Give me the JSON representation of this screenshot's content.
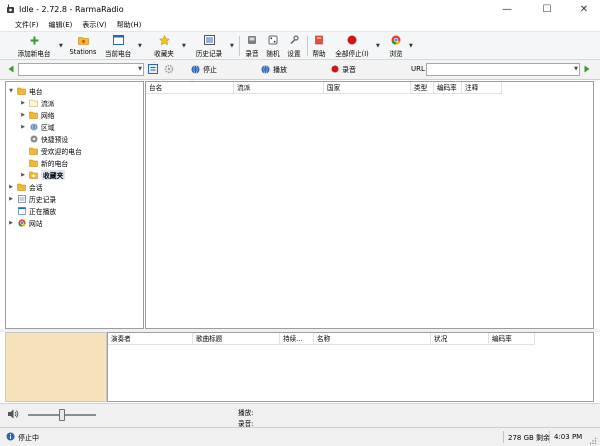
{
  "window": {
    "title": "Idle - 2.72.8 - RarmaRadio",
    "controls": {
      "minimize": "—",
      "maximize": "☐",
      "close": "✕"
    }
  },
  "menu": [
    "文件(F)",
    "编辑(E)",
    "表示(V)",
    "帮助(H)"
  ],
  "toolbar": {
    "add_station": "添加新电台",
    "stations": "Stations",
    "current_station": "当前电台",
    "favorites": "收藏夹",
    "history": "历史记录",
    "record": "录音",
    "random": "随机",
    "settings": "设置",
    "help": "帮助",
    "stop_all": "全部停止(I)",
    "browse": "浏览"
  },
  "address_bar": {
    "station_value": "",
    "stop": "停止",
    "play": "播放",
    "record": "录音",
    "url_label": "URL",
    "url_value": ""
  },
  "tree": [
    {
      "label": "电台",
      "icon": "radio-icon",
      "expanded": true
    },
    {
      "label": "流派",
      "icon": "folder-icon"
    },
    {
      "label": "网络",
      "icon": "network-folder-icon"
    },
    {
      "label": "区域",
      "icon": "globe-icon"
    },
    {
      "label": "快捷预设",
      "icon": "preset-icon"
    },
    {
      "label": "受欢迎的电台",
      "icon": "star-folder-icon"
    },
    {
      "label": "新的电台",
      "icon": "new-folder-icon"
    },
    {
      "label": "收藏夹",
      "icon": "favorites-icon",
      "selected": true
    },
    {
      "label": "会话",
      "icon": "session-icon"
    },
    {
      "label": "历史记录",
      "icon": "history-icon"
    },
    {
      "label": "正在播放",
      "icon": "now-playing-icon"
    },
    {
      "label": "网站",
      "icon": "chrome-icon"
    }
  ],
  "station_columns": [
    "台名",
    "流派",
    "国家",
    "类型",
    "编码率",
    "注释"
  ],
  "song_columns": [
    "演奏者",
    "歌曲标题",
    "持续...",
    "名称",
    "状况",
    "编码率"
  ],
  "player": {
    "playing_label": "播放:",
    "recording_label": "录音:"
  },
  "status": {
    "state": "停止中",
    "disk": "278 GB 剩余",
    "time": "4:03 PM"
  },
  "colors": {
    "accent_green": "#3a9a35",
    "record_red": "#d01818",
    "art_bg": "#f7e1b9"
  }
}
